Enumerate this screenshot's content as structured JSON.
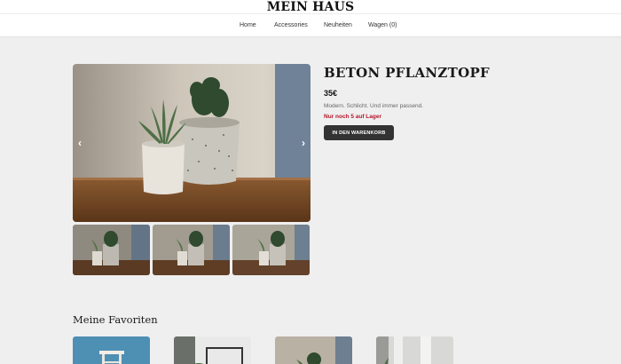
{
  "header": {
    "brand": "MEIN HAUS",
    "nav": [
      {
        "label": "Home"
      },
      {
        "label": "Accessories"
      },
      {
        "label": "Neuheiten"
      },
      {
        "label": "Wagen (0)"
      }
    ]
  },
  "product": {
    "title": "BETON PFLANZTOPF",
    "price": "35€",
    "description": "Modern. Schlicht. Und immer passend.",
    "stock": "Nur noch 5 auf Lager",
    "cart_button": "IN DEN WARENKORB",
    "prev_arrow": "‹",
    "next_arrow": "›",
    "image_count": 3
  },
  "favorites": {
    "title": "Meine Favoriten",
    "items": [
      {
        "icon": "stool-product-image"
      },
      {
        "icon": "wire-shelf-product-image"
      },
      {
        "icon": "plant-pot-product-image"
      },
      {
        "icon": "curtain-room-product-image"
      }
    ]
  },
  "colors": {
    "page_bg": "#efefef",
    "button_bg": "#333333",
    "stock_red": "#b5152b"
  }
}
